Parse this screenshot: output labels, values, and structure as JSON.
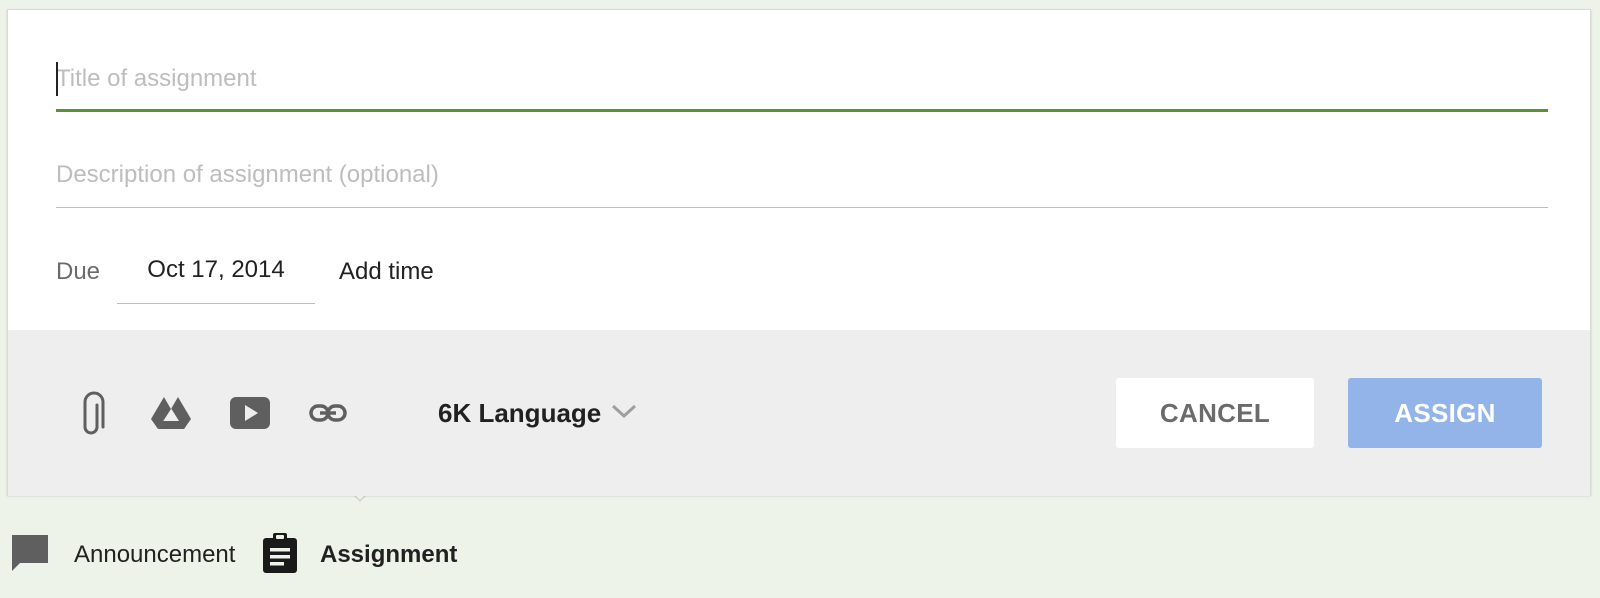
{
  "form": {
    "title_placeholder": "Title of assignment",
    "description_placeholder": "Description of assignment (optional)",
    "due_label": "Due",
    "due_date": "Oct 17, 2014",
    "add_time_label": "Add time"
  },
  "toolbar": {
    "icons": [
      "paperclip-icon",
      "google-drive-icon",
      "youtube-icon",
      "link-icon"
    ],
    "course_name": "6K Language",
    "cancel_label": "CANCEL",
    "assign_label": "ASSIGN"
  },
  "tabs": {
    "announcement_label": "Announcement",
    "assignment_label": "Assignment"
  },
  "colors": {
    "accent_green": "#5a9236",
    "assign_button": "#92b4e8",
    "toolbar_bg": "#eeeeee",
    "page_bg": "#eef3ea"
  }
}
